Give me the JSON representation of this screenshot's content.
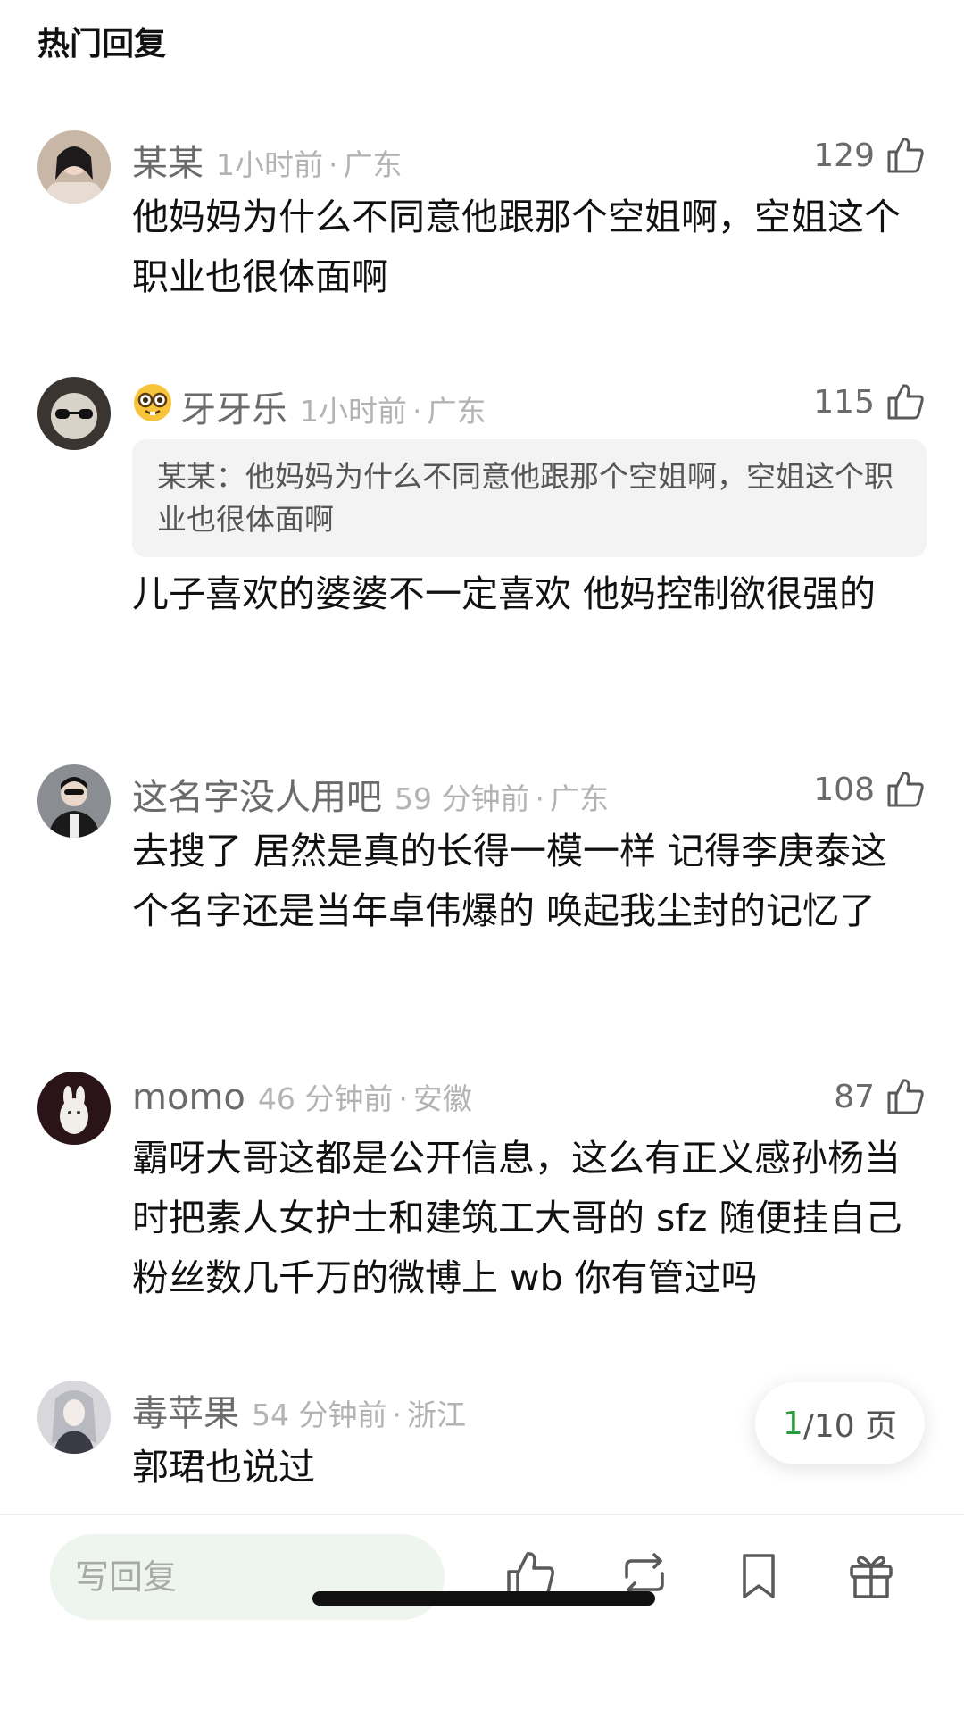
{
  "section_title": "热门回复",
  "comments": [
    {
      "username": "某某",
      "time": "1小时前",
      "location": "广东",
      "likes": "129",
      "text": "他妈妈为什么不同意他跟那个空姐啊，空姐这个职业也很体面啊"
    },
    {
      "username": "牙牙乐",
      "badge_icon": "nerd-face-emoji-icon",
      "time": "1小时前",
      "location": "广东",
      "likes": "115",
      "quote": "某某：他妈妈为什么不同意他跟那个空姐啊，空姐这个职业也很体面啊",
      "text": "儿子喜欢的婆婆不一定喜欢 他妈控制欲很强的"
    },
    {
      "username": "这名字没人用吧",
      "time": "59 分钟前",
      "location": "广东",
      "likes": "108",
      "text": "去搜了 居然是真的长得一模一样 记得李庚泰这个名字还是当年卓伟爆的 唤起我尘封的记忆了"
    },
    {
      "username": "momo",
      "time": "46 分钟前",
      "location": "安徽",
      "likes": "87",
      "text": "霸呀大哥这都是公开信息，这么有正义感孙杨当时把素人女护士和建筑工大哥的 sfz 随便挂自己粉丝数几千万的微博上 wb 你有管过吗"
    },
    {
      "username": "毒苹果",
      "time": "54 分钟前",
      "location": "浙江",
      "likes": "",
      "text": "郭珺也说过"
    }
  ],
  "pager": {
    "current": "1",
    "total": "/10 页"
  },
  "bottom_bar": {
    "reply_placeholder": "写回复",
    "icons": [
      "thumbs-up-icon",
      "repost-icon",
      "bookmark-icon",
      "gift-icon"
    ]
  },
  "colors": {
    "accent_green": "#2b9a3e",
    "username_gray": "#6b6b6b",
    "meta_gray": "#b3b3b3",
    "quote_bg": "#f3f3f3",
    "input_bg": "#eef4ee"
  }
}
